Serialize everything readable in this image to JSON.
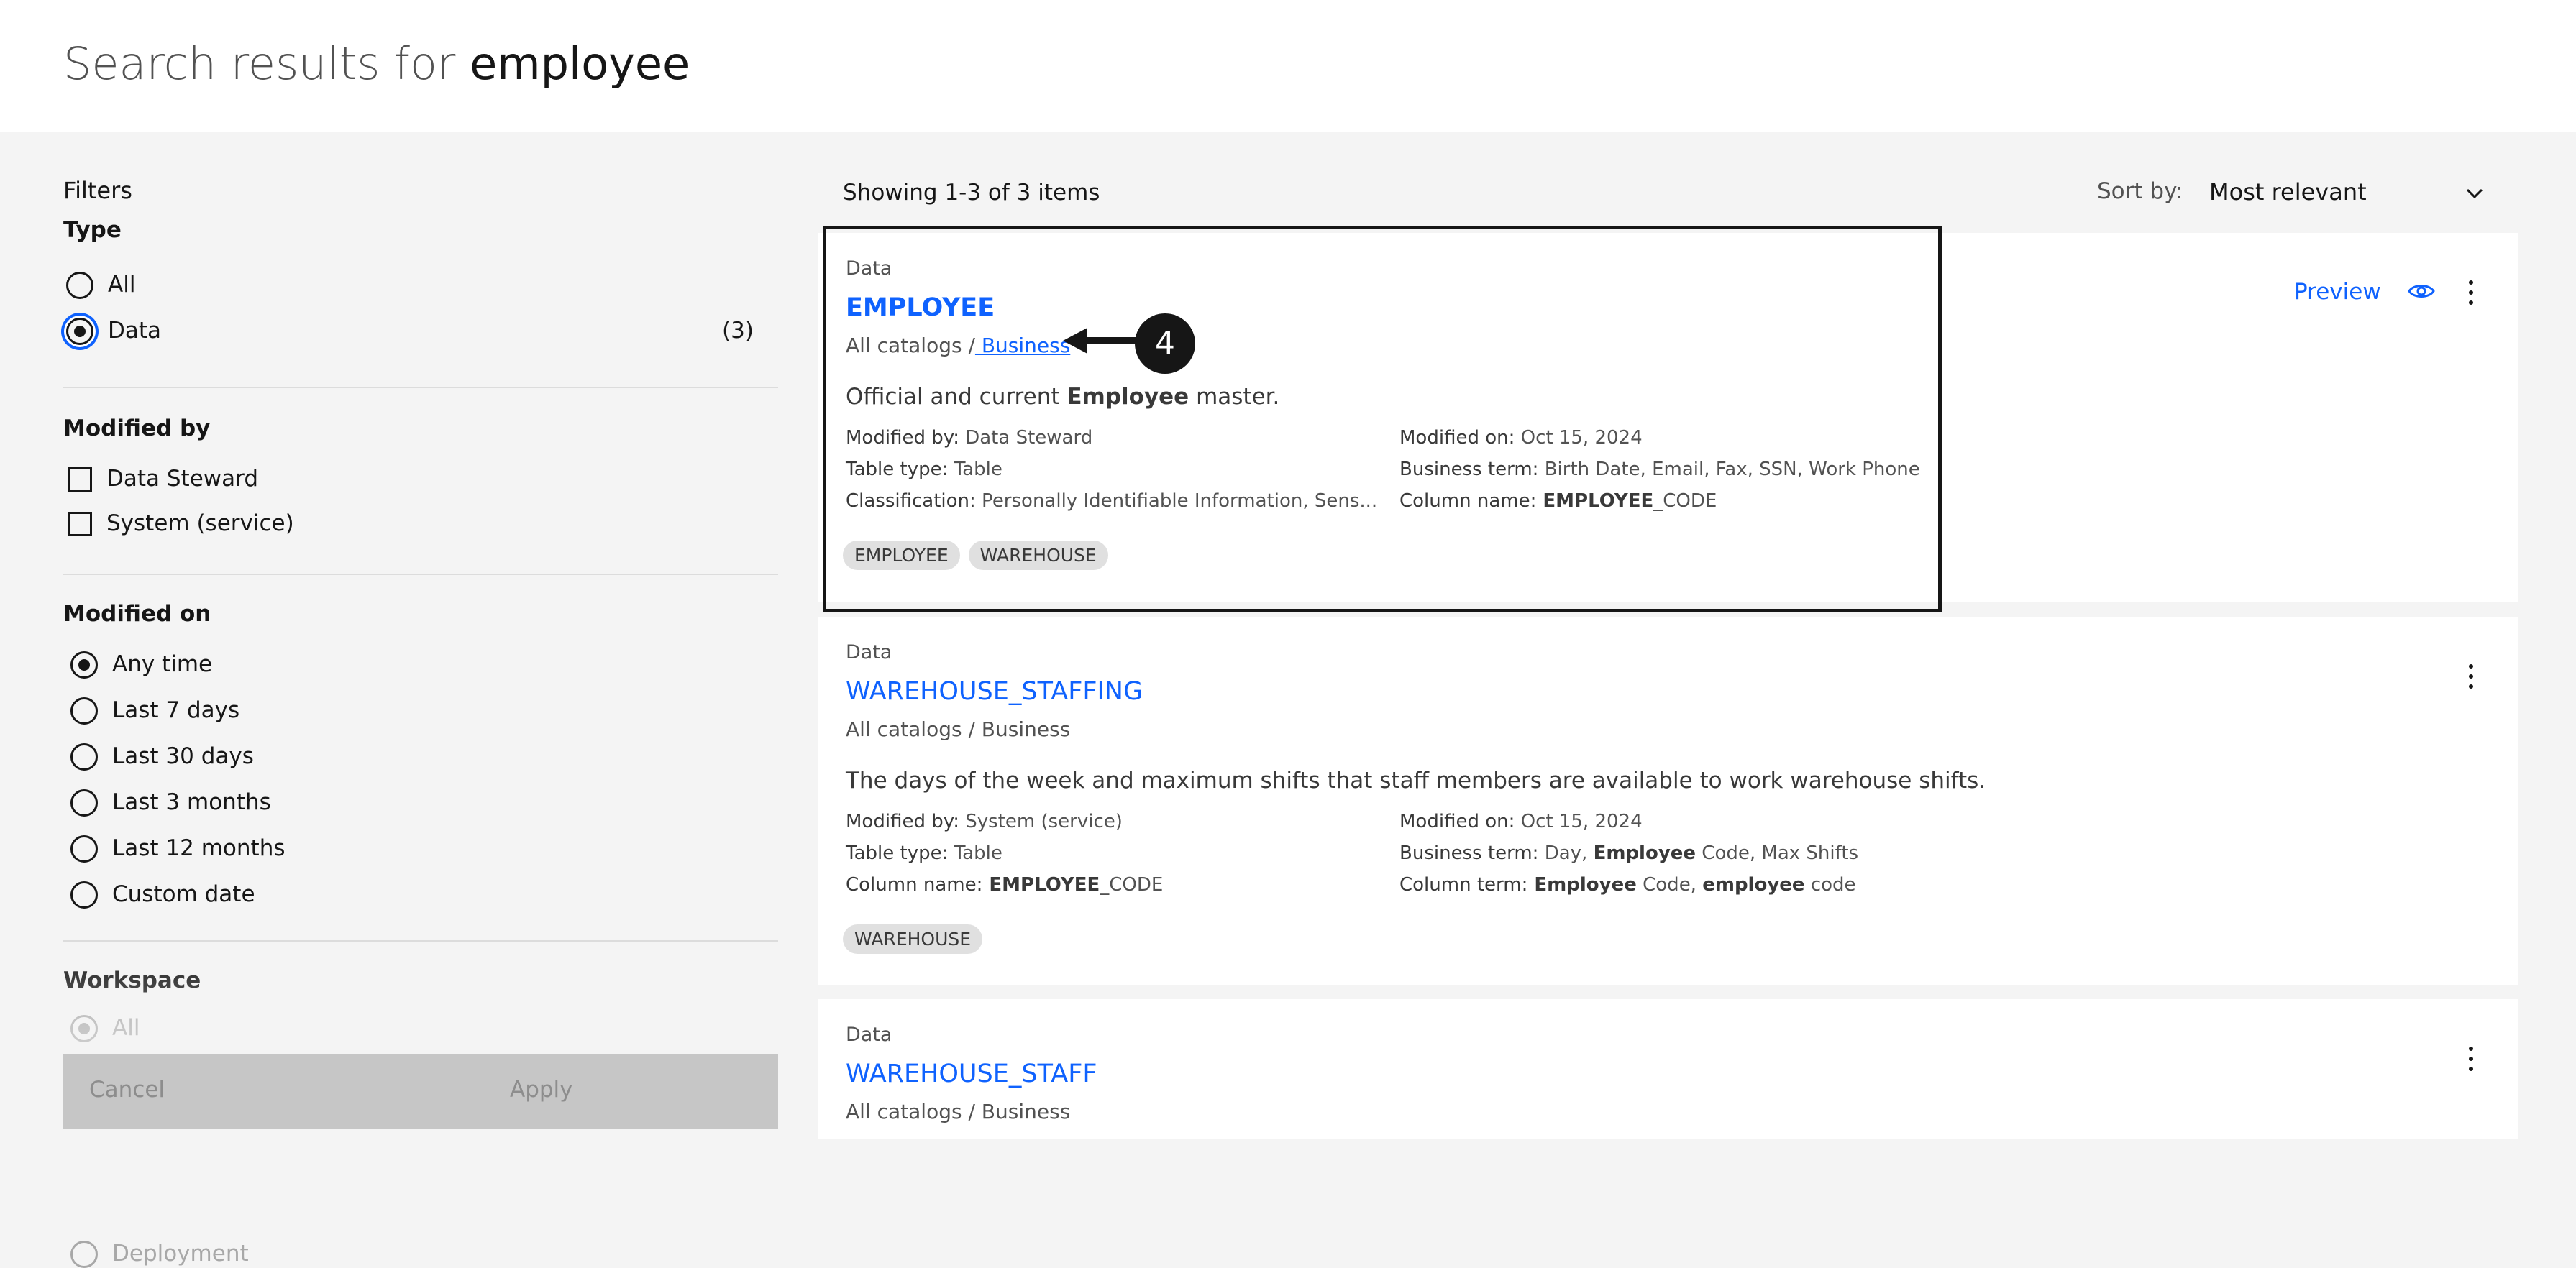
{
  "header": {
    "title_prefix": "Search results for",
    "keyword": "employee"
  },
  "filters": {
    "heading": "Filters",
    "type": {
      "label": "Type",
      "options": [
        {
          "label": "All",
          "checked": false
        },
        {
          "label": "Data",
          "count": "(3)",
          "checked": true
        }
      ]
    },
    "modified_by": {
      "label": "Modified by",
      "options": [
        "Data Steward",
        "System (service)"
      ]
    },
    "modified_on": {
      "label": "Modified on",
      "options": [
        "Any time",
        "Last 7 days",
        "Last 30 days",
        "Last 3 months",
        "Last 12 months",
        "Custom date"
      ],
      "selected": "Any time"
    },
    "workspace": {
      "label": "Workspace",
      "options": [
        "All",
        "Deployment"
      ]
    },
    "actions": {
      "cancel": "Cancel",
      "apply": "Apply"
    }
  },
  "results": {
    "showing": "Showing 1-3 of 3 items",
    "sort": {
      "label": "Sort by:",
      "value": "Most relevant"
    },
    "preview_label": "Preview",
    "items": [
      {
        "type": "Data",
        "title": "EMPLOYEE",
        "path_prefix": "All catalogs /",
        "path_link": " Business",
        "desc_pre": "Official and current ",
        "desc_kw": "Employee",
        "desc_post": " master.",
        "meta_left": [
          {
            "key": "Modified by:",
            "value": " Data Steward"
          },
          {
            "key": "Table type:",
            "value": " Table"
          },
          {
            "key": "Classification:",
            "value": " Personally Identifiable Information, Sens..."
          }
        ],
        "meta_right": [
          {
            "key": "Modified on:",
            "value": " Oct 15, 2024"
          },
          {
            "key": "Business term:",
            "value": " Birth Date, Email, Fax, SSN, Work Phone"
          },
          {
            "key": "Column name:",
            "value_bold": " EMPLOYEE",
            "value": "_CODE"
          }
        ],
        "tags": [
          "EMPLOYEE",
          "WAREHOUSE"
        ]
      },
      {
        "type": "Data",
        "title": "WAREHOUSE_STAFFING",
        "path": "All catalogs / Business",
        "desc": "The days of the week and maximum shifts that staff members are available to work warehouse shifts.",
        "meta_left": [
          {
            "key": "Modified by:",
            "value": " System (service)"
          },
          {
            "key": "Table type:",
            "value": " Table"
          },
          {
            "key": "Column name:",
            "value_bold": " EMPLOYEE",
            "value": "_CODE"
          }
        ],
        "meta_right": [
          {
            "key": "Modified on:",
            "value": " Oct 15, 2024"
          },
          {
            "key": "Business term:",
            "v1": " Day, ",
            "b1": "Employee",
            "v2": " Code, Max Shifts"
          },
          {
            "key": "Column term:",
            "b1": " Employee",
            "v1": " Code, ",
            "b2": "employee",
            "v2": " code"
          }
        ],
        "tags": [
          "WAREHOUSE"
        ]
      },
      {
        "type": "Data",
        "title": "WAREHOUSE_STAFF",
        "path": "All catalogs / Business"
      }
    ]
  },
  "annotation": {
    "step": "4"
  },
  "colors": {
    "link": "#0f62fe",
    "focus": "#0f62fe",
    "tag_bg": "#e0e0e0",
    "page_bg": "#f4f4f4"
  }
}
